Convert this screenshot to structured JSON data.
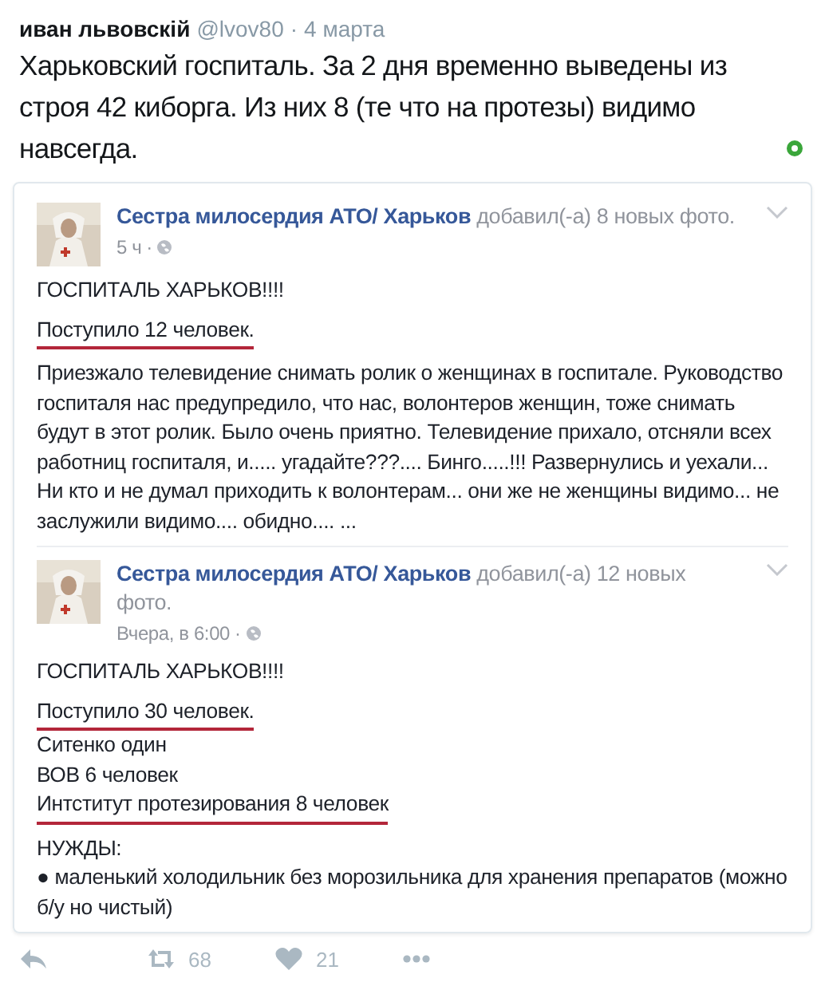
{
  "tweet": {
    "author": "иван львовскій",
    "handle": "@lvov80",
    "separator": "·",
    "date": "4 марта",
    "text": "Харьковский госпиталь. За 2 дня временно выведены из строя 42 киборга. Из них 8 (те что на протезы) видимо навсегда.",
    "embed": {
      "kind": "picture",
      "posts": [
        {
          "page": "Сестра милосердия АТО/ Харьков",
          "action": "добавил(-а) 8 новых фото.",
          "time": "5 ч",
          "separator": "·",
          "paragraphs": [
            [
              {
                "text": "ГОСПИТАЛЬ ХАРЬКОВ!!!!",
                "underlined": false
              }
            ],
            [
              {
                "text": "Поступило 12 человек.",
                "underlined": true
              }
            ],
            [
              {
                "text": "Приезжало телевидение снимать ролик о женщинах в госпитале. Руководство госпиталя нас предупредило, что нас, волонтеров женщин, тоже снимать будут в этот ролик. Было очень приятно. Телевидение прихало, отсняли всех работниц госпиталя, и..... угадайте???.... Бинго.....!!! Развернулись и уехали... Ни кто и не думал приходить к волонтерам... они же не женщины видимо... не заслужили видимо.... обидно.... ...",
                "underlined": false
              }
            ]
          ]
        },
        {
          "page": "Сестра милосердия АТО/ Харьков",
          "action": "добавил(-а) 12 новых фото.",
          "time": "Вчера, в 6:00",
          "separator": "·",
          "paragraphs": [
            [
              {
                "text": "ГОСПИТАЛЬ ХАРЬКОВ!!!!",
                "underlined": false
              }
            ],
            [
              {
                "text": "Поступило 30 человек.",
                "underlined": true
              },
              {
                "text": "Ситенко один",
                "underlined": false
              },
              {
                "text": "ВОВ 6 человек",
                "underlined": false
              },
              {
                "text": "Интститут протезирования 8 человек",
                "underlined": true
              }
            ],
            [
              {
                "text": "НУЖДЫ:",
                "underlined": false
              },
              {
                "text": "● маленький холодильник без морозильника для хранения препаратов (можно б/у но чистый)",
                "underlined": false
              }
            ]
          ]
        }
      ]
    },
    "retweets": "68",
    "likes": "21"
  }
}
